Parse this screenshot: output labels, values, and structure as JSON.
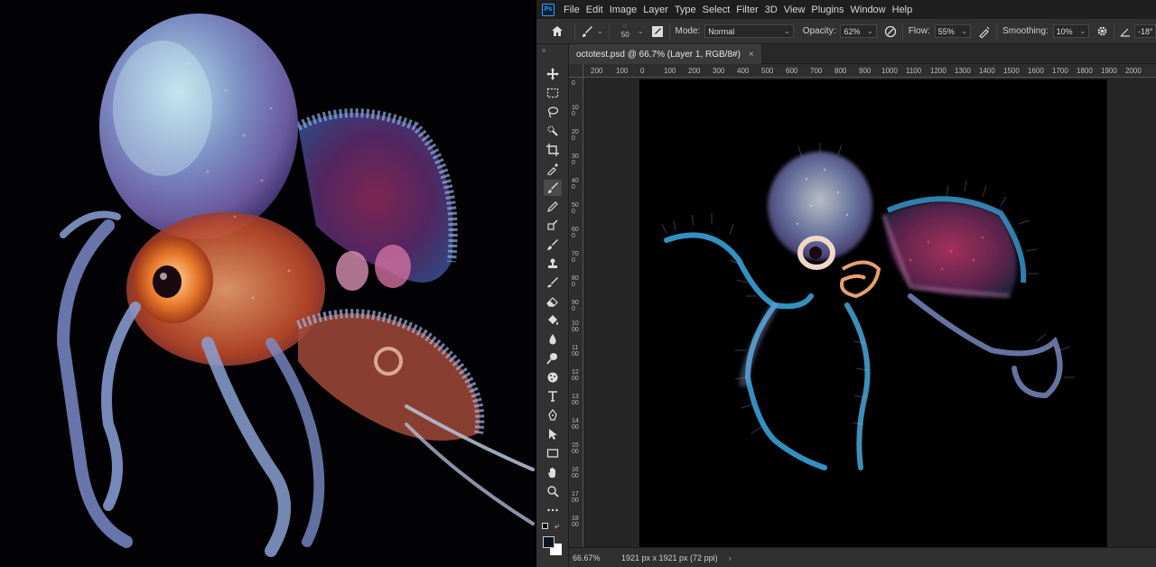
{
  "menu": {
    "logo": "Ps",
    "items": [
      "File",
      "Edit",
      "Image",
      "Layer",
      "Type",
      "Select",
      "Filter",
      "3D",
      "View",
      "Plugins",
      "Window",
      "Help"
    ]
  },
  "options": {
    "brush_size": "50",
    "mode_label": "Mode:",
    "mode_value": "Normal",
    "opacity_label": "Opacity:",
    "opacity_value": "62%",
    "flow_label": "Flow:",
    "flow_value": "55%",
    "smoothing_label": "Smoothing:",
    "smoothing_value": "10%",
    "angle_value": "-18°"
  },
  "document": {
    "tab_title": "octotest.psd @ 66.7% (Layer 1, RGB/8#)",
    "close": "×"
  },
  "ruler": {
    "top": [
      "200",
      "100",
      "0",
      "100",
      "200",
      "300",
      "400",
      "500",
      "600",
      "700",
      "800",
      "900",
      "1000",
      "1100",
      "1200",
      "1300",
      "1400",
      "1500",
      "1600",
      "1700",
      "1800",
      "1900",
      "2000"
    ],
    "left": [
      "0",
      "100",
      "200",
      "300",
      "400",
      "500",
      "600",
      "700",
      "800",
      "900",
      "1000",
      "1100",
      "1200",
      "1300",
      "1400",
      "1500",
      "1600",
      "1700",
      "1800"
    ]
  },
  "status": {
    "zoom": "66.67%",
    "doc_size": "1921 px x 1921 px (72 ppi)",
    "arrow": "›"
  },
  "toolbar": {
    "collapse": "»",
    "tools": [
      "move-tool-icon",
      "marquee-tool-icon",
      "lasso-tool-icon",
      "quick-select-tool-icon",
      "crop-tool-icon",
      "eyedropper-tool-icon",
      "brush-tool-icon",
      "pencil-tool-icon",
      "clone-stamp-tool-icon",
      "history-brush-tool-icon",
      "stamp-tool-icon",
      "healing-tool-icon",
      "eraser-tool-icon",
      "paint-bucket-tool-icon",
      "blur-tool-icon",
      "dodge-tool-icon",
      "sponge-tool-icon",
      "type-tool-icon",
      "pen-tool-icon",
      "path-select-tool-icon",
      "rectangle-tool-icon",
      "hand-tool-icon",
      "zoom-tool-icon",
      "more-tools-icon"
    ]
  },
  "colors": {
    "foreground": "#0d1320",
    "background": "#ffffff",
    "accent": "#31a8ff"
  }
}
